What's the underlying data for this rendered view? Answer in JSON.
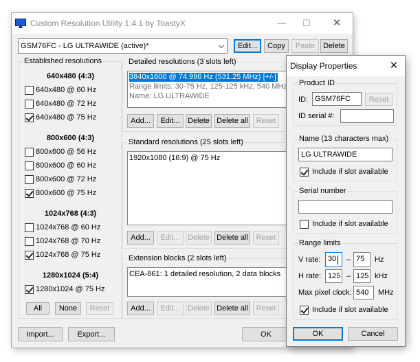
{
  "main": {
    "title": "Custom Resolution Utility 1.4.1 by ToastyX",
    "monitor_combo": "GSM76FC - LG ULTRAWIDE (active)*",
    "top_buttons": {
      "edit": "Edit...",
      "copy": "Copy",
      "paste": "Paste",
      "delete": "Delete"
    },
    "established": {
      "label": "Established resolutions",
      "groups": [
        {
          "heading": "640x480 (4:3)",
          "items": [
            {
              "label": "640x480 @ 60 Hz",
              "checked": false
            },
            {
              "label": "640x480 @ 72 Hz",
              "checked": false
            },
            {
              "label": "640x480 @ 75 Hz",
              "checked": true
            }
          ]
        },
        {
          "heading": "800x600 (4:3)",
          "items": [
            {
              "label": "800x600 @ 56 Hz",
              "checked": false
            },
            {
              "label": "800x600 @ 60 Hz",
              "checked": false
            },
            {
              "label": "800x600 @ 72 Hz",
              "checked": false
            },
            {
              "label": "800x600 @ 75 Hz",
              "checked": true
            }
          ]
        },
        {
          "heading": "1024x768 (4:3)",
          "items": [
            {
              "label": "1024x768 @ 60 Hz",
              "checked": false
            },
            {
              "label": "1024x768 @ 70 Hz",
              "checked": false
            },
            {
              "label": "1024x768 @ 75 Hz",
              "checked": true
            }
          ]
        },
        {
          "heading": "1280x1024 (5:4)",
          "items": [
            {
              "label": "1280x1024 @ 75 Hz",
              "checked": true
            }
          ]
        }
      ],
      "buttons": {
        "all": "All",
        "none": "None",
        "reset": "Reset"
      }
    },
    "detailed": {
      "label": "Detailed resolutions (3 slots left)",
      "lines": [
        "3840x1600 @ 74.996 Hz (531.25 MHz) [+/-]",
        "Range limits: 30-75 Hz, 125-125 kHz, 540 MHz",
        "Name: LG ULTRAWIDE"
      ]
    },
    "standard": {
      "label": "Standard resolutions (25 slots left)",
      "lines": [
        "1920x1080 (16:9) @ 75 Hz"
      ]
    },
    "extension": {
      "label": "Extension blocks (2 slots left)",
      "lines": [
        "CEA-861: 1 detailed resolution, 2 data blocks"
      ]
    },
    "list_buttons": {
      "add": "Add...",
      "edit": "Edit...",
      "delete": "Delete",
      "delete_all": "Delete all",
      "reset": "Reset"
    },
    "bottom_buttons": {
      "import": "Import...",
      "export": "Export...",
      "ok": "OK"
    }
  },
  "dialog": {
    "title": "Display Properties",
    "product_id": {
      "label": "Product ID",
      "id_label": "ID:",
      "id_value": "GSM76FC",
      "reset": "Reset",
      "serial_label": "ID serial #:",
      "serial_value": ""
    },
    "name": {
      "label": "Name (13 characters max)",
      "value": "LG ULTRAWIDE",
      "include_label": "Include if slot available",
      "include_checked": true
    },
    "serial": {
      "label": "Serial number",
      "value": "",
      "include_label": "Include if slot available",
      "include_checked": false
    },
    "range": {
      "label": "Range limits",
      "v_label": "V rate:",
      "v_min": "30",
      "v_max": "75",
      "v_unit": "Hz",
      "h_label": "H rate:",
      "h_min": "125",
      "h_max": "125",
      "h_unit": "kHz",
      "clock_label": "Max pixel clock:",
      "clock_value": "540",
      "clock_unit": "MHz",
      "dash": "–",
      "include_label": "Include if slot available",
      "include_checked": true
    },
    "ok": "OK",
    "cancel": "Cancel"
  }
}
